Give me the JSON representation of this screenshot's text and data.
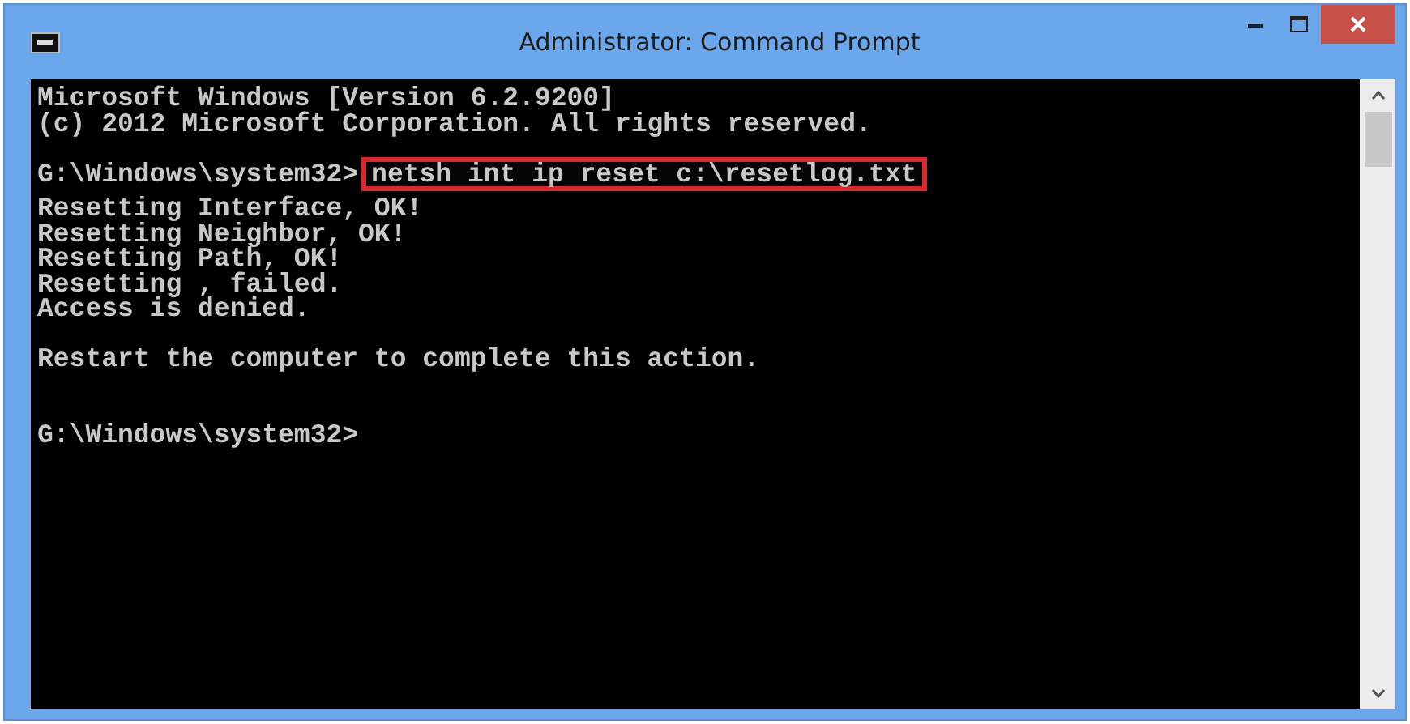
{
  "window": {
    "title": "Administrator: Command Prompt"
  },
  "console": {
    "lines": [
      {
        "kind": "text",
        "segments": [
          {
            "text": "Microsoft Windows [Version 6.2.9200]",
            "highlighted": false
          }
        ]
      },
      {
        "kind": "text",
        "segments": [
          {
            "text": "(c) 2012 Microsoft Corporation. All rights reserved.",
            "highlighted": false
          }
        ]
      },
      {
        "kind": "blank"
      },
      {
        "kind": "text",
        "segments": [
          {
            "text": "G:\\Windows\\system32>",
            "highlighted": false
          },
          {
            "text": "netsh int ip reset c:\\resetlog.txt",
            "highlighted": true
          }
        ]
      },
      {
        "kind": "text",
        "segments": [
          {
            "text": "Resetting Interface, OK!",
            "highlighted": false
          }
        ]
      },
      {
        "kind": "text",
        "segments": [
          {
            "text": "Resetting Neighbor, OK!",
            "highlighted": false
          }
        ]
      },
      {
        "kind": "text",
        "segments": [
          {
            "text": "Resetting Path, OK!",
            "highlighted": false
          }
        ]
      },
      {
        "kind": "text",
        "segments": [
          {
            "text": "Resetting , failed.",
            "highlighted": false
          }
        ]
      },
      {
        "kind": "text",
        "segments": [
          {
            "text": "Access is denied.",
            "highlighted": false
          }
        ]
      },
      {
        "kind": "blank"
      },
      {
        "kind": "text",
        "segments": [
          {
            "text": "Restart the computer to complete this action.",
            "highlighted": false
          }
        ]
      },
      {
        "kind": "blank"
      },
      {
        "kind": "blank"
      },
      {
        "kind": "text",
        "segments": [
          {
            "text": "G:\\Windows\\system32>",
            "highlighted": false
          }
        ]
      }
    ]
  }
}
